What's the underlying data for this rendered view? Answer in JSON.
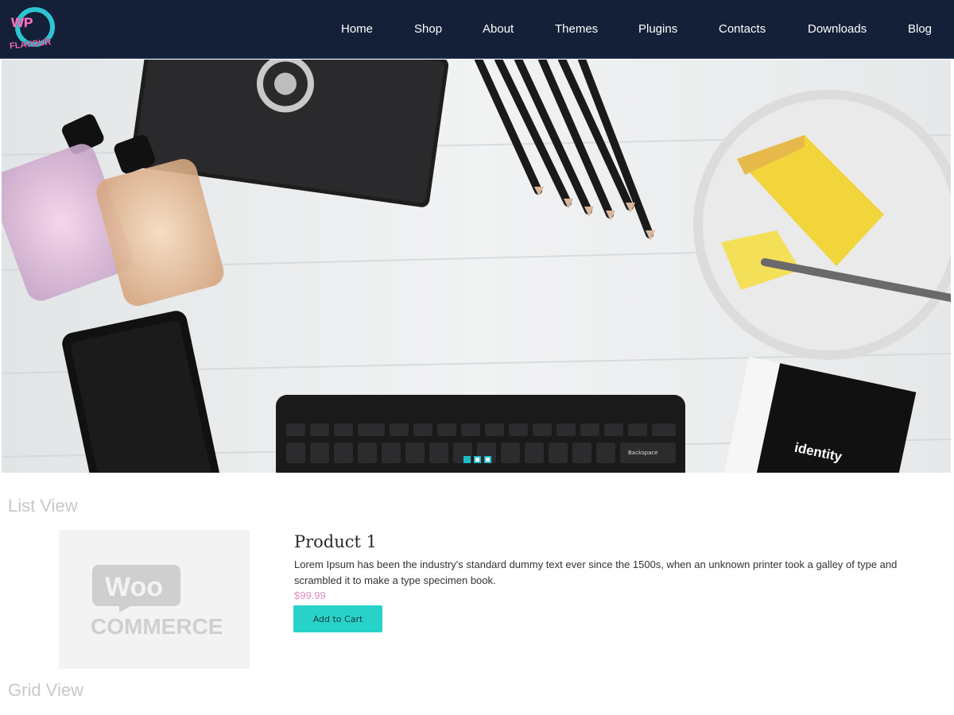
{
  "brand": {
    "logo_top": "WP",
    "logo_bottom": "FLAVOUR"
  },
  "nav": {
    "items": [
      {
        "label": "Home"
      },
      {
        "label": "Shop"
      },
      {
        "label": "About"
      },
      {
        "label": "Themes"
      },
      {
        "label": "Plugins"
      },
      {
        "label": "Contacts"
      },
      {
        "label": "Downloads"
      },
      {
        "label": "Blog"
      }
    ]
  },
  "hero": {
    "slides_total": 3,
    "active_slide": 1,
    "keyboard_key": "Backspace",
    "box_text": "identity"
  },
  "list_view": {
    "title": "List View",
    "product": {
      "image_text_top": "Woo",
      "image_text_bottom": "COMMERCE",
      "name": "Product 1",
      "description": "Lorem Ipsum has been the industry's standard dummy text ever since the 1500s, when an unknown printer took a galley of type and scrambled it to make a type specimen book.",
      "price": "$99.99",
      "button_label": "Add to Cart"
    }
  },
  "grid_view": {
    "title": "Grid View"
  },
  "colors": {
    "nav_bg": "#132038",
    "accent": "#27d3c9",
    "price": "#e08bc0",
    "section_title": "#c8c8c8"
  }
}
